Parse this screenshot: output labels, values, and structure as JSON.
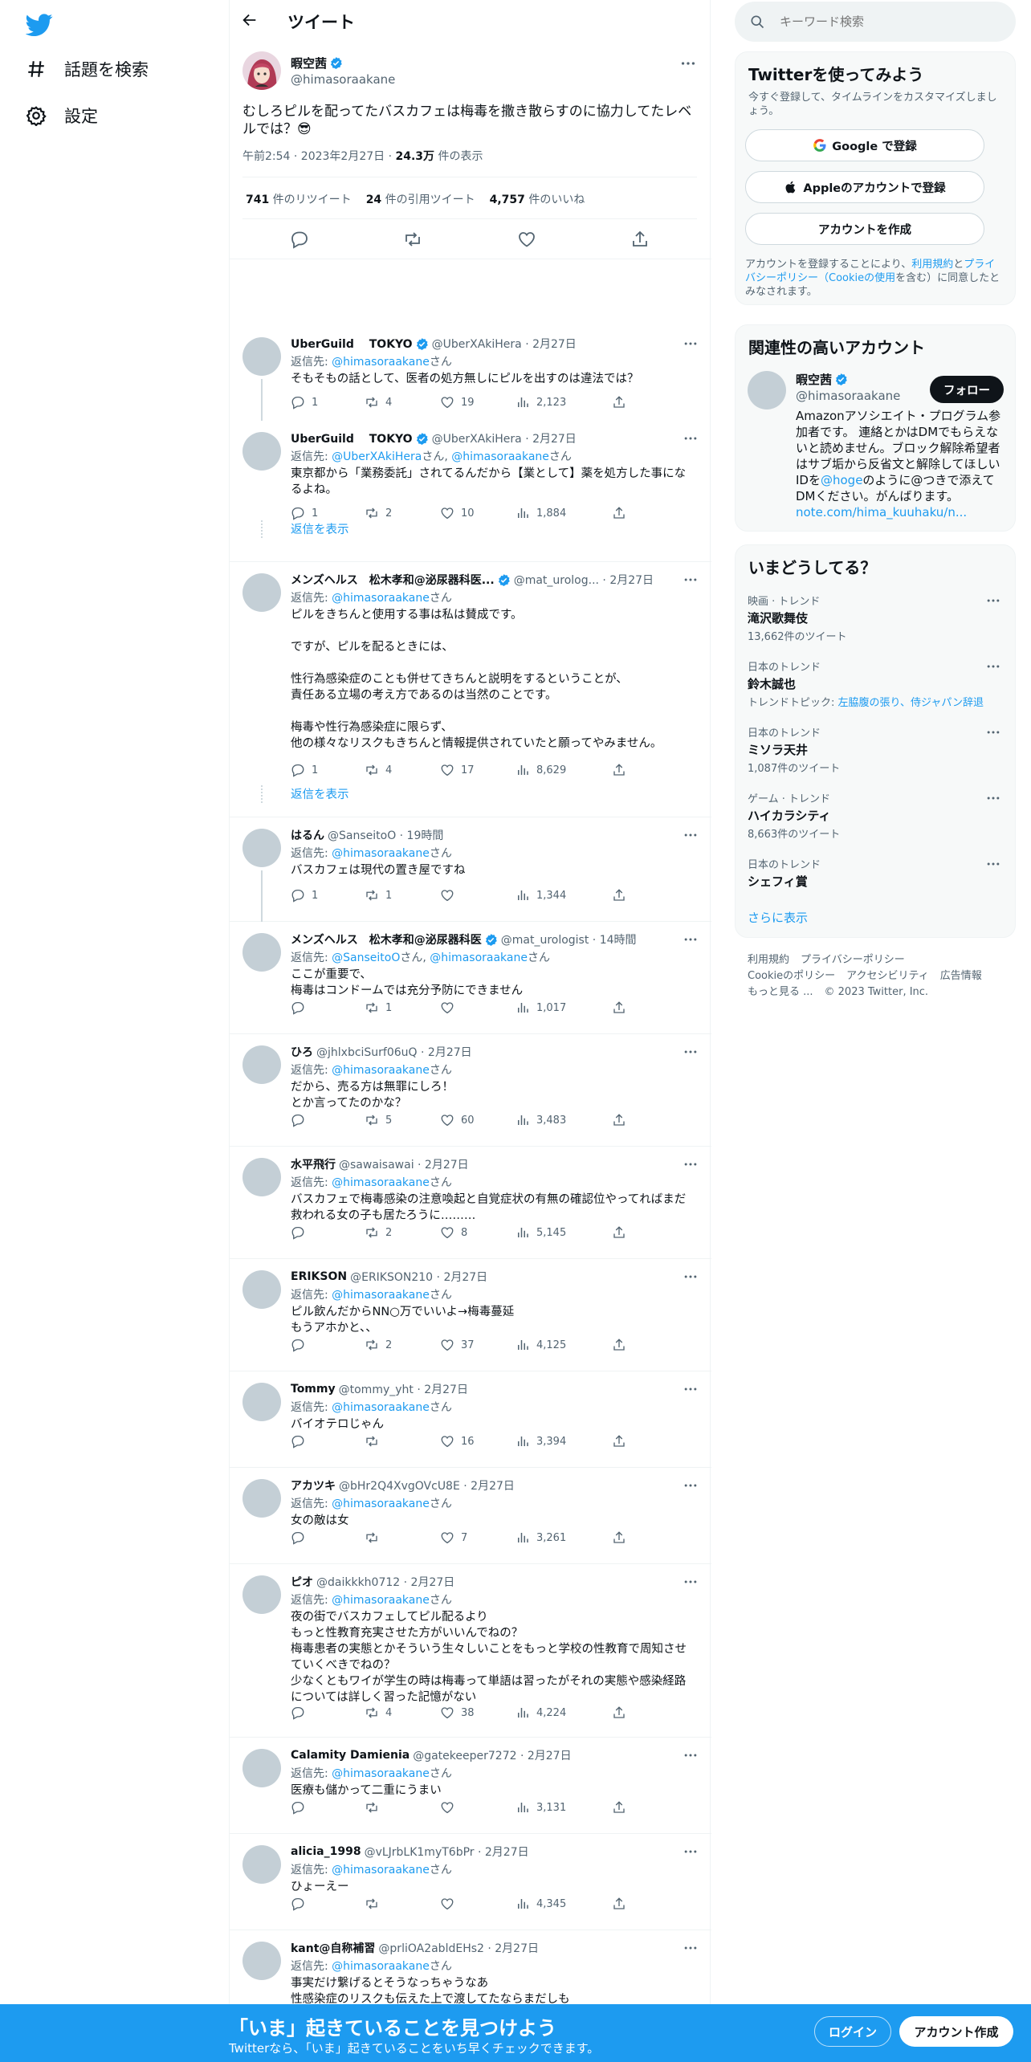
{
  "nav": {
    "explore_label": "話題を検索",
    "settings_label": "設定"
  },
  "header": {
    "title": "ツイート"
  },
  "focal": {
    "name": "暇空茜",
    "handle": "@himasoraakane",
    "text": "むしろピルを配ってたバスカフェは梅毒を撒き散らすのに協力してたレベルでは？😎",
    "time": "午前2:54 · 2023年2月27日 · ",
    "views": "24.3万",
    "views_label": " 件の表示",
    "retweets": "741",
    "retweets_label": " 件のリツイート",
    "quotes": "24",
    "quotes_label": " 件の引用ツイート",
    "likes": "4,757",
    "likes_label": " 件のいいね"
  },
  "replies": [
    {
      "name": "UberGuild　 TOKYO",
      "handle": "@UberXAkiHera · 2月27日",
      "reply_prefix": "返信先: ",
      "reply_to": "@himasoraakane",
      "reply_suffix": "さん",
      "text": "そもそもの話として、医者の処方無しにピルを出すのは違法では？",
      "replies": "1",
      "retweets": "4",
      "likes": "19",
      "views": "2,123"
    },
    {
      "name": "UberGuild　 TOKYO",
      "handle": "@UberXAkiHera · 2月27日",
      "reply_prefix": "返信先: ",
      "reply_to": "@UberXAkiHera",
      "reply_mid": "さん, ",
      "reply_to2": "@himasoraakane",
      "reply_suffix": "さん",
      "text": "東京都から「業務委託」されてるんだから【業として】薬を処方した事になるよね。",
      "replies": "1",
      "retweets": "2",
      "likes": "10",
      "views": "1,884"
    },
    {
      "name": "メンズヘルス　松木孝和@泌尿器科医...",
      "handle": "@mat_urolog... · 2月27日",
      "reply_prefix": "返信先: ",
      "reply_to": "@himasoraakane",
      "reply_suffix": "さん",
      "text": "ピルをきちんと使用する事は私は賛成です。\n\nですが、ピルを配るときには、\n\n性行為感染症のことも併せてきちんと説明をするということが、\n責任ある立場の考え方であるのは当然のことです。\n\n梅毒や性行為感染症に限らず、\n他の様々なリスクもきちんと情報提供されていたと願ってやみません。",
      "replies": "1",
      "retweets": "4",
      "likes": "17",
      "views": "8,629"
    },
    {
      "name": "はるん",
      "handle": "@SanseitoO · 19時間",
      "reply_prefix": "返信先: ",
      "reply_to": "@himasoraakane",
      "reply_suffix": "さん",
      "text": "バスカフェは現代の置き屋ですね",
      "replies": "1",
      "retweets": "1",
      "likes": "",
      "views": "1,344"
    },
    {
      "name": "メンズヘルス　松木孝和@泌尿器科医",
      "handle": "@mat_urologist · 14時間",
      "reply_prefix": "返信先: ",
      "reply_to": "@SanseitoO",
      "reply_mid": "さん, ",
      "reply_to2": "@himasoraakane",
      "reply_suffix": "さん",
      "text": "ここが重要で、\n梅毒はコンドームでは充分予防にできません",
      "replies": "",
      "retweets": "1",
      "likes": "",
      "views": "1,017"
    },
    {
      "name": "ひろ",
      "handle": "@jhlxbciSurf06uQ · 2月27日",
      "reply_prefix": "返信先: ",
      "reply_to": "@himasoraakane",
      "reply_suffix": "さん",
      "text": "だから、売る方は無罪にしろ！\nとか言ってたのかな？",
      "replies": "",
      "retweets": "5",
      "likes": "60",
      "views": "3,483"
    },
    {
      "name": "水平飛行",
      "handle": "@sawaisawai · 2月27日",
      "reply_prefix": "返信先: ",
      "reply_to": "@himasoraakane",
      "reply_suffix": "さん",
      "text": "バスカフェで梅毒感染の注意喚起と自覚症状の有無の確認位やってればまだ救われる女の子も居たろうに………",
      "replies": "",
      "retweets": "2",
      "likes": "8",
      "views": "5,145"
    },
    {
      "name": "ERIKSON",
      "handle": "@ERIKSON210 · 2月27日",
      "reply_prefix": "返信先: ",
      "reply_to": "@himasoraakane",
      "reply_suffix": "さん",
      "text": "ピル飲んだからNN○万でいいよ→梅毒蔓延\nもうアホかと、、",
      "replies": "",
      "retweets": "2",
      "likes": "37",
      "views": "4,125"
    },
    {
      "name": "Tommy",
      "handle": "@tommy_yht · 2月27日",
      "reply_prefix": "返信先: ",
      "reply_to": "@himasoraakane",
      "reply_suffix": "さん",
      "text": "バイオテロじゃん",
      "replies": "",
      "retweets": "",
      "likes": "16",
      "views": "3,394"
    },
    {
      "name": "アカツキ",
      "handle": "@bHr2Q4XvgOVcU8E · 2月27日",
      "reply_prefix": "返信先: ",
      "reply_to": "@himasoraakane",
      "reply_suffix": "さん",
      "text": "女の敵は女",
      "replies": "",
      "retweets": "",
      "likes": "7",
      "views": "3,261"
    },
    {
      "name": "ピオ",
      "handle": "@daikkkh0712 · 2月27日",
      "reply_prefix": "返信先: ",
      "reply_to": "@himasoraakane",
      "reply_suffix": "さん",
      "text": "夜の街でバスカフェしてピル配るより\nもっと性教育充実させた方がいいんでねの？\n梅毒患者の実態とかそういう生々しいことをもっと学校の性教育で周知させていくべきでねの？\n少なくともワイが学生の時は梅毒って単語は習ったがそれの実態や感染経路については詳しく習った記憶がない",
      "replies": "",
      "retweets": "4",
      "likes": "38",
      "views": "4,224"
    },
    {
      "name": "Calamity Damienia",
      "handle": "@gatekeeper7272 · 2月27日",
      "reply_prefix": "返信先: ",
      "reply_to": "@himasoraakane",
      "reply_suffix": "さん",
      "text": "医療も儲かって二重にうまい",
      "replies": "",
      "retweets": "",
      "likes": "",
      "views": "3,131"
    },
    {
      "name": "alicia_1998",
      "handle": "@vLJrbLK1myT6bPr · 2月27日",
      "reply_prefix": "返信先: ",
      "reply_to": "@himasoraakane",
      "reply_suffix": "さん",
      "text": "ひょーえー",
      "replies": "",
      "retweets": "",
      "likes": "",
      "views": "4,345"
    },
    {
      "name": "kant@自称補習",
      "handle": "@prliOA2abldEHs2 · 2月27日",
      "reply_prefix": "返信先: ",
      "reply_to": "@himasoraakane",
      "reply_suffix": "さん",
      "text": "事実だけ繋げるとそうなっちゃうなあ\n性感染症のリスクも伝えた上で渡してたならまだしも",
      "replies": "",
      "retweets": "",
      "likes": "",
      "views": ""
    }
  ],
  "show_replies_label": "返信を表示",
  "search": {
    "placeholder": "キーワード検索"
  },
  "signup": {
    "title": "Twitterを使ってみよう",
    "subtitle": "今すぐ登録して、タイムラインをカスタマイズしましょう。",
    "google": "Google で登録",
    "apple": "Appleのアカウントで登録",
    "create": "アカウントを作成",
    "legal_1": "アカウントを登録することにより、",
    "legal_terms": "利用規約",
    "legal_2": "と",
    "legal_privacy": "プライバシーポリシー（Cookieの使用",
    "legal_3": "を含む）に同意したとみなされます。"
  },
  "related": {
    "title": "関連性の高いアカウント",
    "name": "暇空茜",
    "handle": "@himasoraakane",
    "follow": "フォロー",
    "bio_1": "Amazonアソシエイト・プログラム参加者です。 連絡とかはDMでもらえないと読めません。ブロック解除希望者はサブ垢から反省文と解除してほしいIDを",
    "bio_link1": "@hoge",
    "bio_2": "のように@つきで添えてDMください。がんばります。",
    "bio_link2": "note.com/hima_kuuhaku/n..."
  },
  "trends": {
    "title": "いまどうしてる？",
    "items": [
      {
        "category": "映画 · トレンド",
        "name": "滝沢歌舞伎",
        "count": "13,662件のツイート"
      },
      {
        "category": "日本のトレンド",
        "name": "鈴木誠也",
        "count_prefix": "トレンドトピック: ",
        "count_link": "左脇腹の張り、侍ジャパン辞退"
      },
      {
        "category": "日本のトレンド",
        "name": "ミソラ天井",
        "count": "1,087件のツイート"
      },
      {
        "category": "ゲーム · トレンド",
        "name": "ハイカラシティ",
        "count": "8,663件のツイート"
      },
      {
        "category": "日本のトレンド",
        "name": "シェフィ賞"
      }
    ],
    "show_more": "さらに表示"
  },
  "footer": {
    "terms": "利用規約",
    "privacy": "プライバシーポリシー",
    "cookie": "Cookieのポリシー",
    "accessibility": "アクセシビリティ",
    "ads": "広告情報",
    "more": "もっと見る ...",
    "copyright": "© 2023 Twitter, Inc."
  },
  "bottombar": {
    "title": "「いま」起きていることを見つけよう",
    "subtitle": "Twitterなら、「いま」起きていることをいち早くチェックできます。",
    "login": "ログイン",
    "signup": "アカウント作成"
  },
  "colors": {
    "accent": "#1d9bf0",
    "text": "#0f1419",
    "muted": "#536471"
  }
}
